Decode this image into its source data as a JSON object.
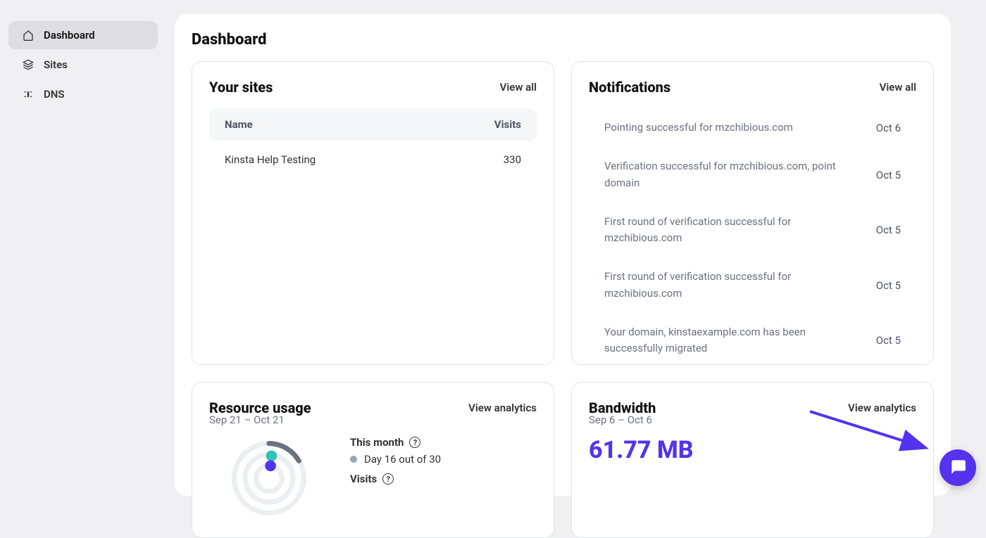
{
  "sidebar": {
    "items": [
      {
        "label": "Dashboard",
        "icon": "home-icon",
        "active": true
      },
      {
        "label": "Sites",
        "icon": "layers-icon",
        "active": false
      },
      {
        "label": "DNS",
        "icon": "dns-icon",
        "active": false
      }
    ]
  },
  "page": {
    "title": "Dashboard"
  },
  "sites": {
    "title": "Your sites",
    "view_all": "View all",
    "col_name": "Name",
    "col_visits": "Visits",
    "rows": [
      {
        "name": "Kinsta Help Testing",
        "visits": "330"
      }
    ]
  },
  "notifications": {
    "title": "Notifications",
    "view_all": "View all",
    "items": [
      {
        "msg": "Pointing successful for mzchibious.com",
        "date": "Oct 6"
      },
      {
        "msg": "Verification successful for mzchibious.com, point domain",
        "date": "Oct 5"
      },
      {
        "msg": "First round of verification successful for mzchibious.com",
        "date": "Oct 5"
      },
      {
        "msg": "First round of verification successful for mzchibious.com",
        "date": "Oct 5"
      },
      {
        "msg": "Your domain, kinstaexample.com has been successfully migrated",
        "date": "Oct 5"
      }
    ]
  },
  "resource": {
    "title": "Resource usage",
    "link": "View analytics",
    "range": "Sep 21 – Oct 21",
    "legend": {
      "month_label": "This month",
      "day_label": "Day 16 out of 30",
      "visits_label": "Visits"
    }
  },
  "bandwidth": {
    "title": "Bandwidth",
    "link": "View analytics",
    "range": "Sep 6 – Oct 6",
    "value": "61.77 MB"
  },
  "colors": {
    "accent": "#5333ed",
    "teal": "#2ec4b6",
    "gray_dot": "#9ca3af"
  }
}
